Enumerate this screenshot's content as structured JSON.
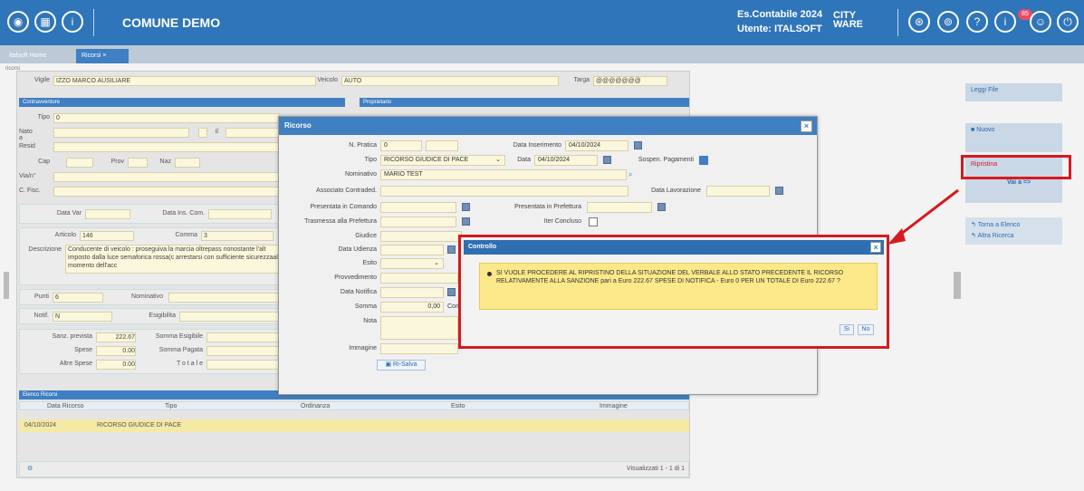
{
  "topbar": {
    "app": "COMUNE DEMO",
    "es_label": "Es.Contabile 2024",
    "user_label": "Utente: ITALSOFT",
    "brand": "CITY WARE",
    "badge": "85"
  },
  "tabs": [
    {
      "label": "Italsoft Home"
    },
    {
      "label": "Ricorsi"
    }
  ],
  "breadcrumb": "ricorsi",
  "form": {
    "vigile_label": "Vigile",
    "vigile": "IZZO MARCO AUSILIARE",
    "veicolo_label": "Veicolo",
    "veicolo": "AUTO",
    "targa_label": "Targa",
    "targa": "@@@@@@@",
    "contravv": "Contravventore",
    "proprietario": "Proprietario",
    "tipo_label": "Tipo",
    "tipo": "0",
    "nato_label": "Nato a",
    "il_label": "il",
    "resid_label": "Resid",
    "cap_label": "Cap",
    "prov_label": "Prov",
    "naz_label": "Naz",
    "via_label": "Via/n°",
    "cf_label": "C. Fisc.",
    "datavar_label": "Data Var",
    "datains_label": "Data Ins. Com.",
    "articolo_label": "Articolo",
    "articolo": "146",
    "comma_label": "Comma",
    "comma": "3",
    "descr_label": "Descrizione",
    "descrizione": "Conducente di veicolo : proseguiva la marcia oltrepass nonostante l'alt imposto dalla luce semaforica rossa(c arrestarsi con sufficiente sicurezzaal momento dell'acc",
    "punti_label": "Punti",
    "punti": "6",
    "nominativo_label": "Nominativo",
    "notif_label": "Notif.",
    "notif": "N",
    "esig_label": "Esigibilita",
    "sanz_label": "Sanz. prevista",
    "sanz": "222.67",
    "somma_esig_label": "Somma Esigibile",
    "spese_label": "Spese",
    "spese": "0.00",
    "somma_pag_label": "Somma Pagata",
    "altre_label": "Altre Spese",
    "altre": "0.00",
    "totale_label": "T o t a l e",
    "elenco": "Elenco Ricorsi",
    "cols": [
      "Data Ricorso",
      "Tipo",
      "Ordinanza",
      "Esito",
      "Immagine"
    ],
    "row": {
      "data": "04/10/2024",
      "tipo": "RICORSO GIUDICE DI PACE"
    },
    "footer": "Visualizzati 1 - 1 di 1"
  },
  "side": {
    "leggi": "Leggi File",
    "nuovo": "Nuovo",
    "ripristina": "Ripristina",
    "vai": "Vai a =>",
    "torna": "Torna a Elenco",
    "altra": "Altra Ricerca"
  },
  "modal": {
    "title": "Ricorso",
    "npratica_label": "N. Pratica",
    "npratica": "0",
    "datains_label": "Data Inserimento",
    "datains": "04/10/2024",
    "tipo_label": "Tipo",
    "tipo": "RICORSO GIUDICE DI PACE",
    "data_label": "Data",
    "data": "04/10/2024",
    "sosp_label": "Sospen. Pagamenti",
    "nom_label": "Nominativo",
    "nom": "MARIO TEST",
    "assoc_label": "Associato Contraded.",
    "datalav_label": "Data Lavorazione",
    "pres_com_label": "Presentata in Comando",
    "pres_pref_label": "Presentata in Prefettura",
    "trasm_label": "Trasmessa alla Prefettura",
    "iter_label": "Iter Concluso",
    "giudice_label": "Giudice",
    "udienza_label": "Data Udienza",
    "esito_label": "Esito",
    "provv_label": "Provvedimento",
    "notif_label": "Data Notifica",
    "somma_label": "Somma",
    "somma": "0,00",
    "somma_suffix": "Com",
    "nota_label": "Nota",
    "immagine_label": "Immagine",
    "save": "Ri-Salva"
  },
  "dialog": {
    "title": "Controllo",
    "message": "SI VUOLE PROCEDERE AL RIPRISTINO DELLA SITUAZIONE DEL VERBALE ALLO STATO PRECEDENTE IL RICORSO RELATIVAMENTE ALLA SANZIONE pari a Euro 222.67  SPESE DI NOTIFICA - Euro  0 PER UN TOTALE DI Euro  222.67 ?",
    "yes": "Si",
    "no": "No"
  },
  "colors": {
    "accent": "#2f75b9",
    "highlight": "#d71920",
    "warning": "#fbe98a"
  }
}
